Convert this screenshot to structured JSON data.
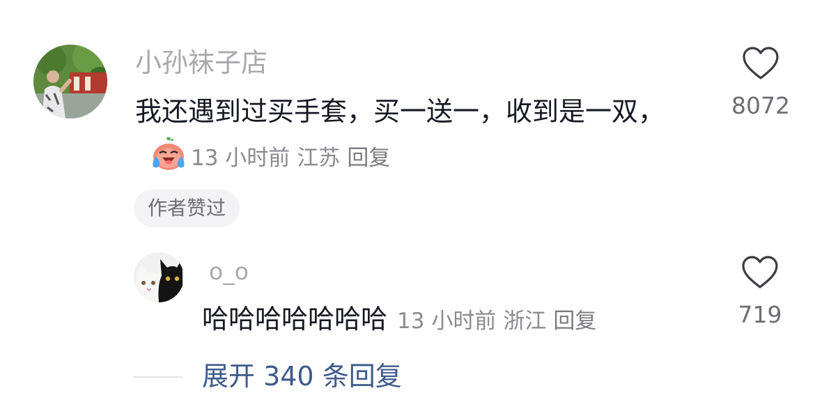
{
  "comment": {
    "username": "小孙袜子店",
    "text": "我还遇到过买手套，买一送一，收到是一双，",
    "emoji": "crying-laughing-emoji",
    "time": "13 小时前",
    "location": "江苏",
    "reply_label": "回复",
    "author_liked": "作者赞过",
    "like_count": "8072"
  },
  "reply": {
    "username": "o_o",
    "text": "哈哈哈哈哈哈哈",
    "time": "13 小时前",
    "location": "浙江",
    "reply_label": "回复",
    "like_count": "719"
  },
  "expand": {
    "label": "展开 340 条回复"
  },
  "icons": {
    "like": "heart-outline-icon"
  },
  "colors": {
    "username": "#a9a9ad",
    "text": "#161823",
    "meta": "#8a8a8f",
    "expand": "#3d5a8a"
  }
}
